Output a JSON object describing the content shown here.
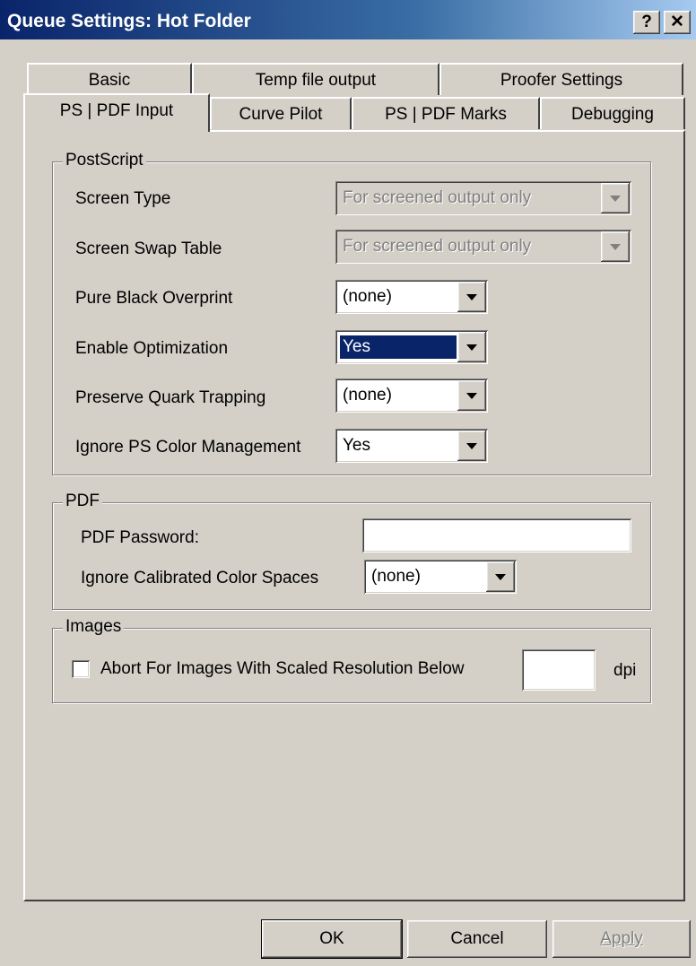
{
  "window": {
    "title": "Queue Settings: Hot Folder",
    "help_glyph": "?",
    "close_glyph": "✕"
  },
  "tabs": {
    "row_back": [
      "Basic",
      "Temp file output",
      "Proofer Settings"
    ],
    "row_front": [
      "PS | PDF Input",
      "Curve Pilot",
      "PS | PDF Marks",
      "Debugging"
    ],
    "active": "PS | PDF Input"
  },
  "postscript": {
    "legend": "PostScript",
    "screen_type": {
      "label": "Screen Type",
      "value": "For screened output only",
      "enabled": false
    },
    "screen_swap_table": {
      "label": "Screen Swap Table",
      "value": "For screened output only",
      "enabled": false
    },
    "pure_black_overprint": {
      "label": "Pure Black Overprint",
      "value": "(none)"
    },
    "enable_optimization": {
      "label": "Enable Optimization",
      "value": "Yes",
      "focused": true
    },
    "preserve_quark_trapping": {
      "label": "Preserve Quark Trapping",
      "value": "(none)"
    },
    "ignore_ps_color_management": {
      "label": "Ignore PS Color Management",
      "value": "Yes"
    }
  },
  "pdf": {
    "legend": "PDF",
    "password": {
      "label": "PDF Password:",
      "value": ""
    },
    "ignore_calibrated": {
      "label": "Ignore Calibrated Color Spaces",
      "value": "(none)"
    }
  },
  "images": {
    "legend": "Images",
    "abort_checkbox": {
      "label": "Abort For Images With Scaled Resolution Below",
      "checked": false
    },
    "dpi_value": "",
    "dpi_unit": "dpi"
  },
  "buttons": {
    "ok": "OK",
    "cancel": "Cancel",
    "apply": "Apply"
  },
  "colors": {
    "title_bar": "#0a246a",
    "face": "#d4d0c8",
    "selection": "#0a246a"
  }
}
